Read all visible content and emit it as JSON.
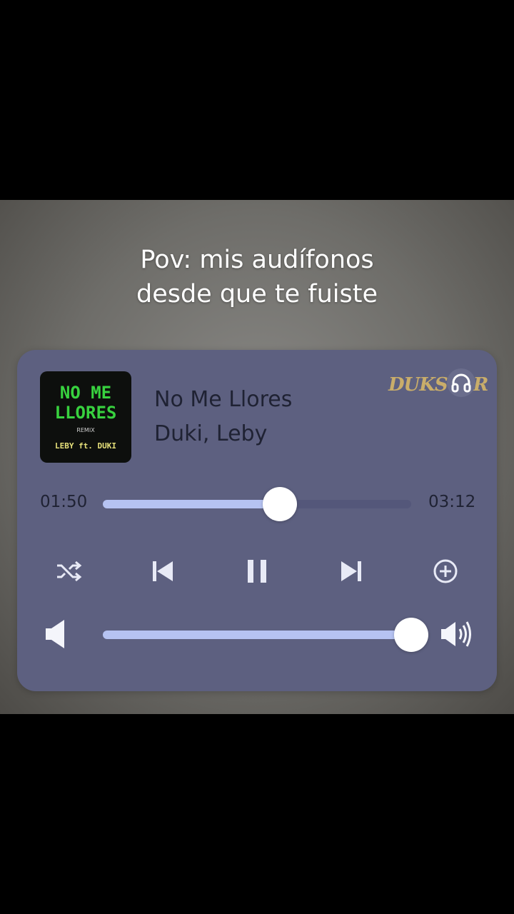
{
  "caption": {
    "line1": "Pov: mis audífonos",
    "line2": "desde que te fuiste"
  },
  "player": {
    "title": "No Me Llores",
    "artist": "Duki, Leby",
    "logo_text": "DUKSTAR",
    "headphone_icon": "headphones-icon",
    "album_art": {
      "title_line1": "NO ME",
      "title_line2": "LLORES",
      "subtitle": "REMIX",
      "credit": "LEBY ft. DUKI"
    },
    "elapsed": "01:50",
    "total": "03:12",
    "progress": 0.573,
    "volume": 1.0,
    "controls": [
      "shuffle-icon",
      "previous-icon",
      "pause-icon",
      "next-icon",
      "add-circle-icon"
    ],
    "colors": {
      "card": "#5d6080",
      "track_fill": "#b6c3f2",
      "track_bg": "#54577a",
      "text": "#1f2233"
    }
  }
}
